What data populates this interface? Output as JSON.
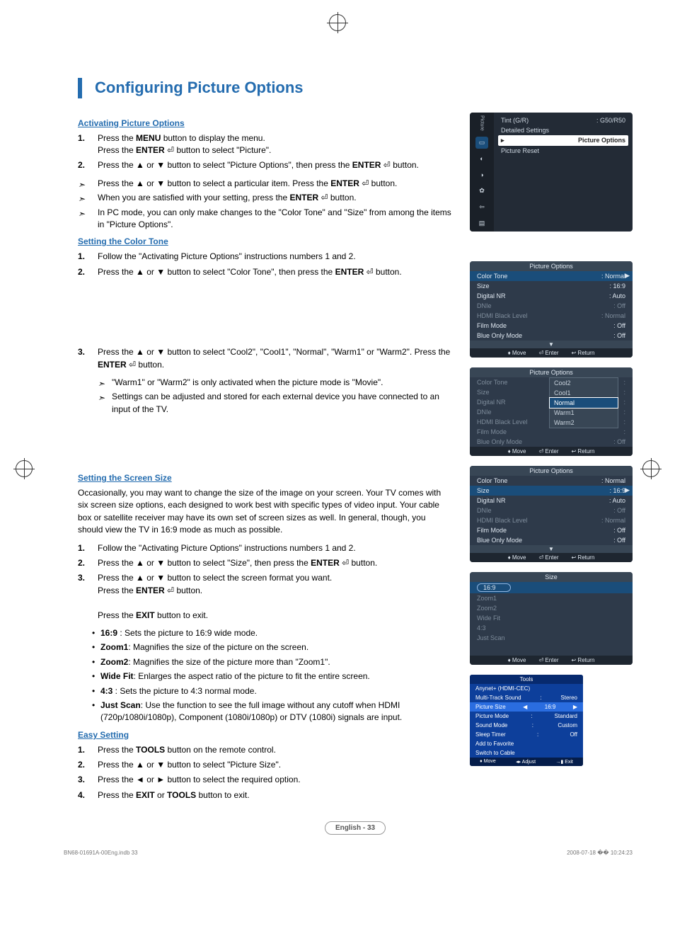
{
  "title": "Configuring Picture Options",
  "page_label": "English - 33",
  "footer_left": "BN68-01691A-00Eng.indb   33",
  "footer_right": "2008-07-18   �� 10:24:23",
  "sec1": {
    "head": "Activating Picture Options",
    "s1a": "Press the ",
    "s1b": "MENU",
    "s1c": " button to display the menu.",
    "s1d": "Press the ",
    "s1e": "ENTER",
    "s1f": " button to select \"Picture\".",
    "s2a": "Press the ▲ or ▼ button to select \"Picture Options\", then press the ",
    "s2b": "ENTER",
    "s2c": " button.",
    "n1a": "Press the ▲ or ▼ button to select a particular item. Press the ",
    "n1b": "ENTER",
    "n1c": " button.",
    "n2a": "When you are satisfied with your setting, press the ",
    "n2b": "ENTER",
    "n2c": " button.",
    "n3": "In PC mode, you can only make changes to the \"Color Tone\" and \"Size\" from among the items in \"Picture Options\"."
  },
  "sec2": {
    "head": "Setting the Color Tone",
    "s1": "Follow the \"Activating Picture Options\" instructions numbers 1 and 2.",
    "s2a": "Press the ▲ or ▼ button to select \"Color Tone\", then press the ",
    "s2b": "ENTER",
    "s2c": " button.",
    "s3a": "Press the ▲ or ▼ button to select \"Cool2\", \"Cool1\", \"Normal\", \"Warm1\" or \"Warm2\". Press the ",
    "s3b": "ENTER",
    "s3c": " button.",
    "n1": "\"Warm1\" or \"Warm2\" is only activated when the picture mode is \"Movie\".",
    "n2": "Settings can be adjusted and stored for each external device you have connected to an input of the TV."
  },
  "sec3": {
    "head": "Setting the Screen Size",
    "intro": "Occasionally, you may want to change the size of the image on your screen. Your TV comes with six screen size options, each designed to work best with specific types of video input. Your cable box or satellite receiver may have its own set of screen sizes as well. In general, though, you should view the TV in 16:9 mode as much as possible.",
    "s1": "Follow the \"Activating Picture Options\" instructions numbers 1 and 2.",
    "s2a": "Press the ▲ or ▼ button to select \"Size\", then press the ",
    "s2b": "ENTER",
    "s2c": " button.",
    "s3a": "Press the ▲ or ▼ button to select the screen format you want.",
    "s3b": "Press the ",
    "s3c": "ENTER",
    "s3d": " button.",
    "s3e": "Press the ",
    "s3f": "EXIT",
    "s3g": " button to exit.",
    "b1": " : Sets the picture to 16:9 wide mode.",
    "b1h": "16:9",
    "b2h": "Zoom1",
    "b2": ": Magnifies the size of the picture on the screen.",
    "b3h": "Zoom2",
    "b3": ": Magnifies the size of the picture more than \"Zoom1\".",
    "b4h": "Wide Fit",
    "b4": ": Enlarges the aspect ratio of the picture to fit the entire screen.",
    "b5h": "4:3",
    "b5": " : Sets the picture to 4:3 normal mode.",
    "b6h": "Just Scan",
    "b6": ": Use the function to see the full image without any cutoff when HDMI (720p/1080i/1080p), Component (1080i/1080p) or DTV (1080i) signals are input."
  },
  "sec4": {
    "head": "Easy Setting",
    "s1a": "Press the ",
    "s1b": "TOOLS",
    "s1c": " button on the remote control.",
    "s2": "Press the ▲ or ▼ button to select \"Picture Size\".",
    "s3": "Press the ◄ or ► button to select the required option.",
    "s4a": "Press the ",
    "s4b": "EXIT",
    "s4c": " or ",
    "s4d": "TOOLS",
    "s4e": " button to exit."
  },
  "menu1": {
    "side": "Picture",
    "r1l": "Tint (G/R)",
    "r1v": ": G50/R50",
    "r2": "Detailed Settings",
    "r3": "Picture Options",
    "r4": "Picture Reset"
  },
  "osd_foot": {
    "m": "♦ Move",
    "e": "⏎ Enter",
    "r": "↩ Return"
  },
  "po": {
    "title": "Picture Options",
    "r": [
      {
        "l": "Color Tone",
        "v": ": Normal"
      },
      {
        "l": "Size",
        "v": ": 16:9"
      },
      {
        "l": "Digital NR",
        "v": ": Auto"
      },
      {
        "l": "DNIe",
        "v": ": Off"
      },
      {
        "l": "HDMI Black Level",
        "v": ": Normal"
      },
      {
        "l": "Film Mode",
        "v": ": Off"
      },
      {
        "l": "Blue Only Mode",
        "v": ": Off"
      }
    ],
    "drop": [
      "Cool2",
      "Cool1",
      "Normal",
      "Warm1",
      "Warm2"
    ]
  },
  "size_menu": {
    "title": "Size",
    "items": [
      "16:9",
      "Zoom1",
      "Zoom2",
      "Wide Fit",
      "4:3",
      "Just Scan"
    ]
  },
  "tools": {
    "title": "Tools",
    "rows": [
      {
        "l": "Anynet+ (HDMI-CEC)",
        "v": ""
      },
      {
        "l": "Multi-Track Sound",
        "v": "Stereo"
      },
      {
        "l": "Picture Size",
        "v": "16:9"
      },
      {
        "l": "Picture Mode",
        "v": "Standard"
      },
      {
        "l": "Sound Mode",
        "v": "Custom"
      },
      {
        "l": "Sleep Timer",
        "v": "Off"
      },
      {
        "l": "Add to Favorite",
        "v": ""
      },
      {
        "l": "Switch to Cable",
        "v": ""
      }
    ],
    "foot": {
      "m": "♦ Move",
      "a": "◂▸ Adjust",
      "e": "→▮ Exit"
    }
  }
}
